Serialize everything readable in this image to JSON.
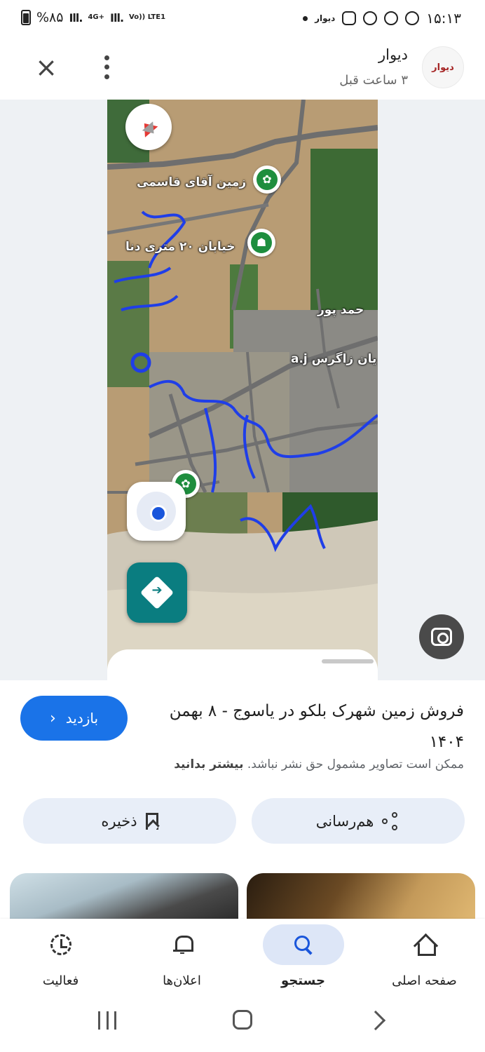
{
  "status_bar": {
    "battery": "%۸۵",
    "network_1": "4G+",
    "network_2": "Vo)) LTE1",
    "time": "۱۵:۱۳",
    "app_label": "دیوار"
  },
  "header": {
    "site_name": "دیوار",
    "time_ago": "۳ ساعت قبل",
    "logo_text": "دیوار"
  },
  "map": {
    "labels": [
      "زمین آقای قاسمی",
      "خیابان ۲۰ متری دنا",
      "حمد پور",
      "یان زاگرس a.j"
    ],
    "colors": {
      "accent": "#1a73e8",
      "route_ink": "#1f3ee8",
      "poi_green": "#1e8e3e",
      "directions_teal": "#0a7d80"
    }
  },
  "details": {
    "title": "فروش زمین شهرک بلکو در یاسوج - ۸ بهمن ۱۴۰۴",
    "visit_label": "بازدید",
    "disclaimer": "ممکن است تصاویر مشمول حق نشر نباشد.",
    "learn_more": "بیشتر بدانید",
    "share_label": "هم‌رسانی",
    "save_label": "ذخیره"
  },
  "bottom_nav": {
    "items": [
      {
        "label": "صفحه اصلی",
        "icon": "home-icon"
      },
      {
        "label": "جستجو",
        "icon": "search-icon",
        "active": true
      },
      {
        "label": "اعلان‌ها",
        "icon": "bell-icon"
      },
      {
        "label": "فعالیت",
        "icon": "activity-icon"
      }
    ]
  }
}
